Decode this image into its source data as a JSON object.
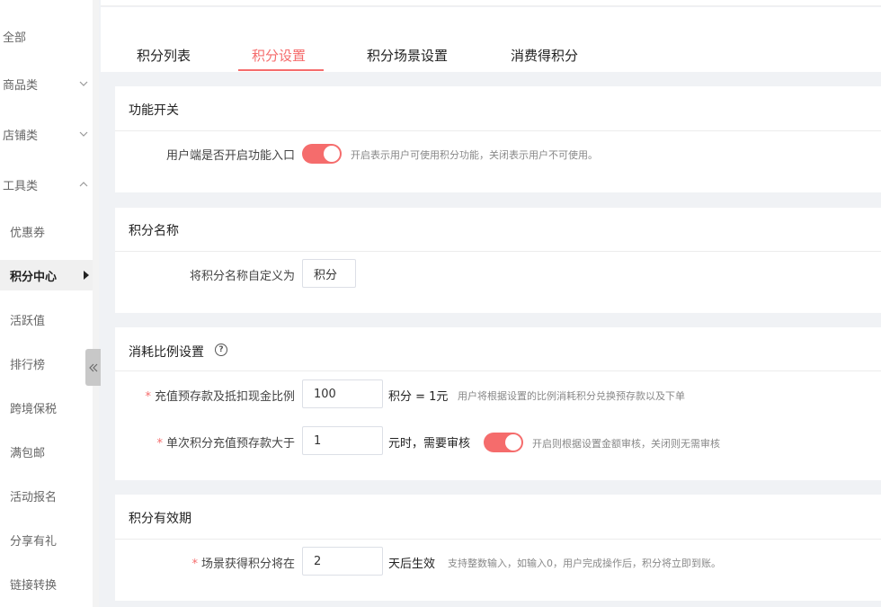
{
  "sidebar": {
    "items": [
      {
        "label": "全部"
      },
      {
        "label": "商品类"
      },
      {
        "label": "店铺类"
      },
      {
        "label": "工具类"
      },
      {
        "label": "优惠券"
      },
      {
        "label": "积分中心"
      },
      {
        "label": "活跃值"
      },
      {
        "label": "排行榜"
      },
      {
        "label": "跨境保税"
      },
      {
        "label": "满包邮"
      },
      {
        "label": "活动报名"
      },
      {
        "label": "分享有礼"
      },
      {
        "label": "链接转换"
      }
    ]
  },
  "tabs": [
    {
      "label": "积分列表"
    },
    {
      "label": "积分设置"
    },
    {
      "label": "积分场景设置"
    },
    {
      "label": "消费得积分"
    }
  ],
  "colors": {
    "accent": "#f56c6c"
  },
  "feature_switch": {
    "title": "功能开关",
    "label": "用户端是否开启功能入口",
    "enabled": true,
    "hint": "开启表示用户可使用积分功能，关闭表示用户不可使用。"
  },
  "points_name": {
    "title": "积分名称",
    "label": "将积分名称自定义为",
    "value": "积分"
  },
  "ratio": {
    "title": "消耗比例设置",
    "help_icon": "?",
    "row1_label": "充值预存款及抵扣现金比例",
    "row1_value": "100",
    "row1_suffix": "积分 = 1元",
    "row1_hint": "用户将根据设置的比例消耗积分兑换预存款以及下单",
    "row2_label": "单次积分充值预存款大于",
    "row2_value": "1",
    "row2_suffix": "元时，需要审核",
    "row2_enabled": true,
    "row2_hint": "开启则根据设置金额审核，关闭则无需审核"
  },
  "validity": {
    "title": "积分有效期",
    "label": "场景获得积分将在",
    "value": "2",
    "suffix": "天后生效",
    "hint": "支持整数输入，如输入0，用户完成操作后，积分将立即到账。"
  },
  "required_mark": "*"
}
